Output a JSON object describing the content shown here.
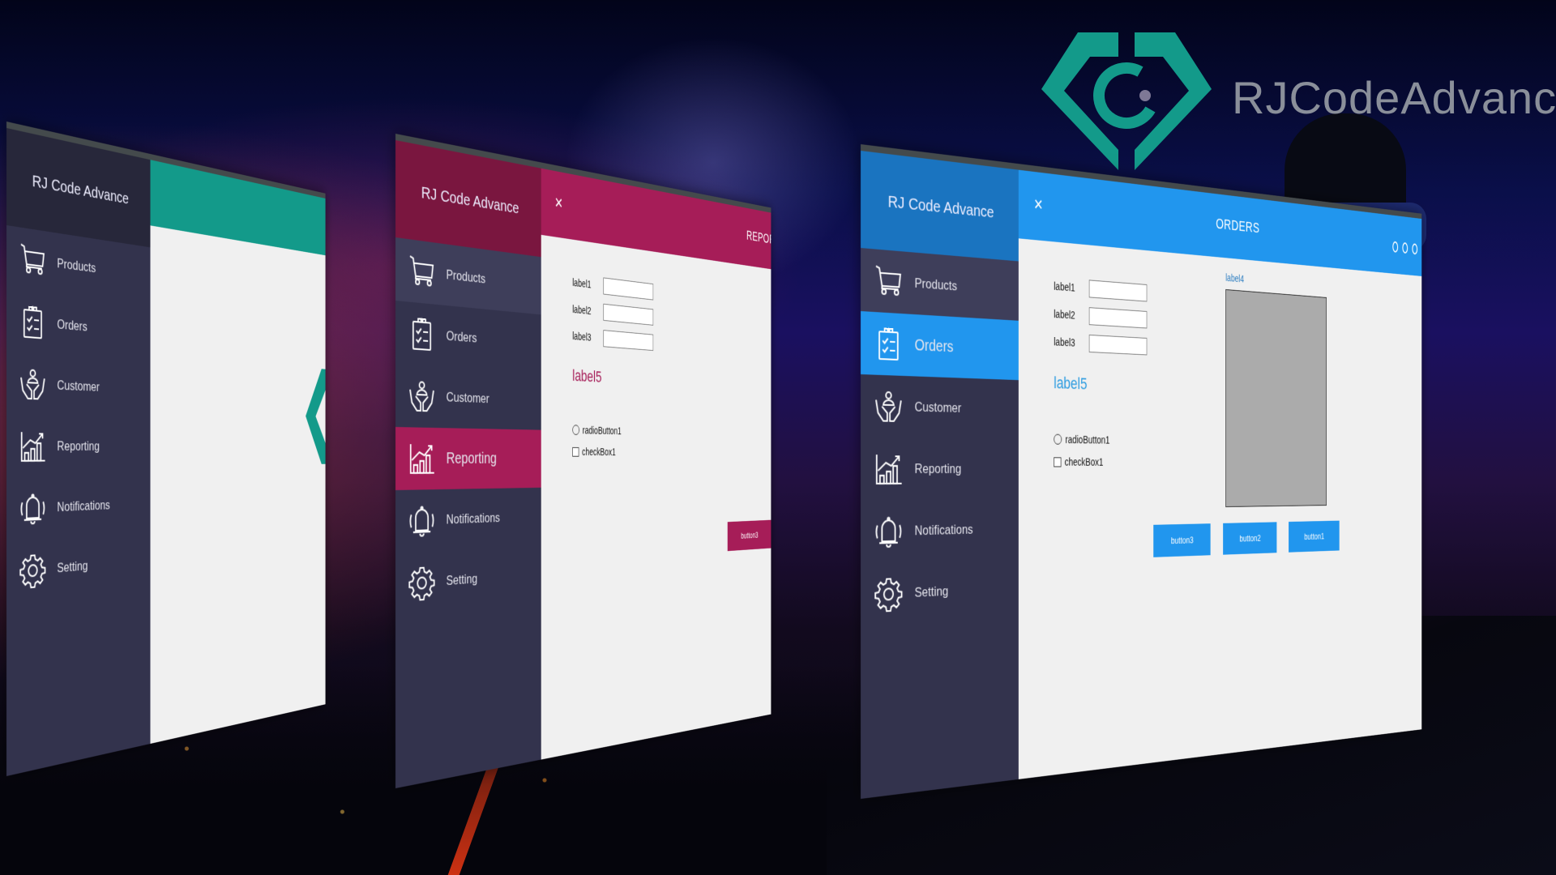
{
  "background": {
    "description": "night sky with moon over city, grass and a man looking at the logo"
  },
  "brand": {
    "logo_icon": "rjcode-diamond-logo-icon",
    "name": "RJCodeAdvance",
    "logo_color": "#139a8a"
  },
  "windows": [
    {
      "theme": "teal",
      "colors": {
        "accent": "#139a8a",
        "sidebar": "#33334d",
        "sidebar_head": "#27273a",
        "content": "#f0f0f0"
      },
      "sidebar_title": "RJ Code Advance",
      "active_item": null,
      "nav": [
        {
          "label": "Products",
          "icon": "cart-icon"
        },
        {
          "label": "Orders",
          "icon": "clipboard-checklist-icon"
        },
        {
          "label": "Customer",
          "icon": "hands-user-icon"
        },
        {
          "label": "Reporting",
          "icon": "bar-chart-growth-icon"
        },
        {
          "label": "Notifications",
          "icon": "bell-icon"
        },
        {
          "label": "Setting",
          "icon": "gear-icon"
        }
      ]
    },
    {
      "theme": "crimson",
      "colors": {
        "accent": "#a61d58",
        "sidebar": "#33334d",
        "sidebar_head": "#7a163f",
        "active": "#a61d58",
        "hover": "#3e3e5a",
        "content": "#f0f0f0"
      },
      "sidebar_title": "RJ Code Advance",
      "active_item": "Reporting",
      "close_label": "×",
      "title": "REPORTING",
      "nav": [
        {
          "label": "Products",
          "icon": "cart-icon"
        },
        {
          "label": "Orders",
          "icon": "clipboard-checklist-icon"
        },
        {
          "label": "Customer",
          "icon": "hands-user-icon"
        },
        {
          "label": "Reporting",
          "icon": "bar-chart-growth-icon"
        },
        {
          "label": "Notifications",
          "icon": "bell-icon"
        },
        {
          "label": "Setting",
          "icon": "gear-icon"
        }
      ],
      "form": {
        "fields": [
          {
            "label": "label1",
            "value": ""
          },
          {
            "label": "label2",
            "value": ""
          },
          {
            "label": "label3",
            "value": ""
          }
        ],
        "label5": "label5",
        "radio": "radioButton1",
        "checkbox": "checkBox1",
        "buttons": [
          "button3"
        ]
      }
    },
    {
      "theme": "blue",
      "colors": {
        "accent": "#2196ee",
        "sidebar": "#33334d",
        "sidebar_head": "#1a74c0",
        "active": "#2196ee",
        "hover": "#3e3e5a",
        "content": "#f0f0f0",
        "picture": "#ababab"
      },
      "sidebar_title": "RJ Code Advance",
      "active_item": "Orders",
      "close_label": "×",
      "title": "ORDERS",
      "nav": [
        {
          "label": "Products",
          "icon": "cart-icon"
        },
        {
          "label": "Orders",
          "icon": "clipboard-checklist-icon"
        },
        {
          "label": "Customer",
          "icon": "hands-user-icon"
        },
        {
          "label": "Reporting",
          "icon": "bar-chart-growth-icon"
        },
        {
          "label": "Notifications",
          "icon": "bell-icon"
        },
        {
          "label": "Setting",
          "icon": "gear-icon"
        }
      ],
      "form": {
        "fields": [
          {
            "label": "label1",
            "value": ""
          },
          {
            "label": "label2",
            "value": ""
          },
          {
            "label": "label3",
            "value": ""
          }
        ],
        "label4": "label4",
        "label5": "label5",
        "radio": "radioButton1",
        "checkbox": "checkBox1",
        "buttons": [
          "button3",
          "button2",
          "button1"
        ]
      }
    }
  ]
}
